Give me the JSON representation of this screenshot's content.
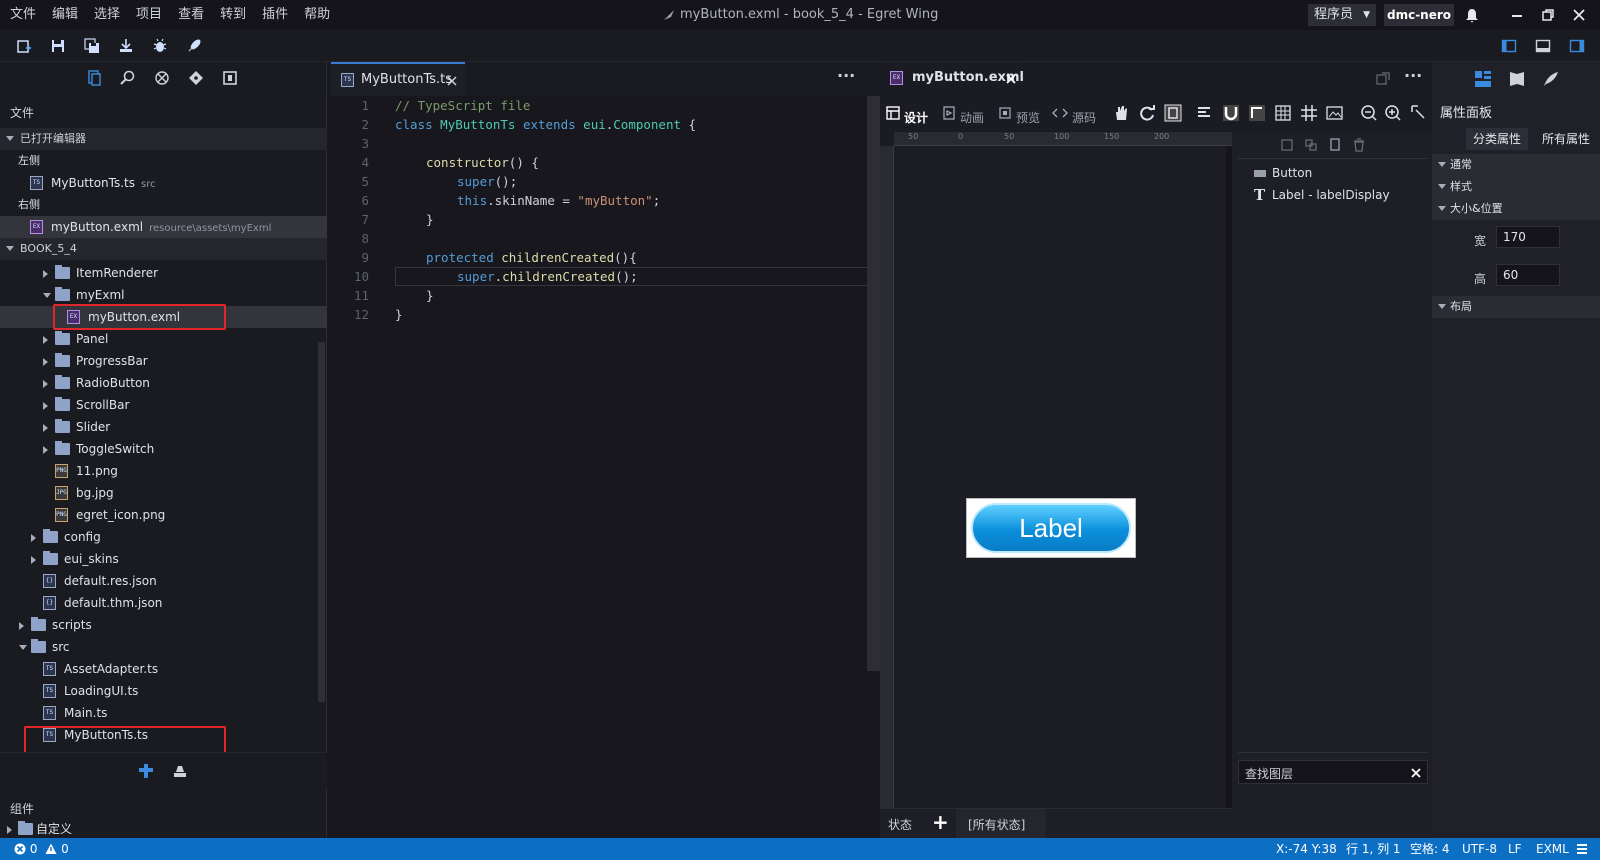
{
  "titlebar": {
    "menu": [
      "文件",
      "编辑",
      "选择",
      "项目",
      "查看",
      "转到",
      "插件",
      "帮助"
    ],
    "window_title": "myButton.exml - book_5_4 - Egret Wing",
    "role": "程序员",
    "role_arrow": "▼",
    "user": "dmc-nero"
  },
  "icons": {
    "bell": "bell-icon",
    "minimize": "minimize-icon",
    "restore": "restore-icon",
    "close": "close-icon"
  },
  "left_panel": {
    "section_files": "文件",
    "open_editors_head": "已打开编辑器",
    "left_group": "左侧",
    "left_file": "MyButtonTs.ts",
    "left_file_sub": "src",
    "right_group": "右侧",
    "right_file": "myButton.exml",
    "right_file_sub": "resource\\assets\\myExml",
    "project_head": "BOOK_5_4",
    "tree": {
      "item_renderer": "ItemRenderer",
      "my_exml": "myExml",
      "my_button_exml": "myButton.exml",
      "panel": "Panel",
      "progress_bar": "ProgressBar",
      "radio_button": "RadioButton",
      "scroll_bar": "ScrollBar",
      "slider": "Slider",
      "toggle_switch": "ToggleSwitch",
      "png11": "11.png",
      "bg": "bg.jpg",
      "egret_icon": "egret_icon.png",
      "config": "config",
      "eui_skins": "eui_skins",
      "default_res": "default.res.json",
      "default_thm": "default.thm.json",
      "scripts": "scripts",
      "src": "src",
      "asset_adapter": "AssetAdapter.ts",
      "loading_ui": "LoadingUI.ts",
      "main": "Main.ts",
      "my_button_ts": "MyButtonTs.ts"
    },
    "components_head": "组件",
    "custom": "自定义"
  },
  "editor": {
    "tab_label": "MyButtonTs.ts",
    "more": "···",
    "lines": [
      {
        "n": "1"
      },
      {
        "n": "2"
      },
      {
        "n": "3"
      },
      {
        "n": "4"
      },
      {
        "n": "5"
      },
      {
        "n": "6"
      },
      {
        "n": "7"
      },
      {
        "n": "8"
      },
      {
        "n": "9"
      },
      {
        "n": "10"
      },
      {
        "n": "11"
      },
      {
        "n": "12"
      }
    ],
    "code": {
      "l1": "// TypeScript file",
      "l2_kw": "class",
      "l2_name": " MyButtonTs ",
      "l2_ext": "extends",
      "l2_base": " eui",
      "l2_dot": ".",
      "l2_comp": "Component",
      "l2_end": " {",
      "l4_fn": "constructor",
      "l4_end": "() {",
      "l5_kw": "super",
      "l5_end": "();",
      "l6_this": "this",
      "l6_prop": ".skinName = ",
      "l6_str": "\"myButton\"",
      "l6_end": ";",
      "l7": "}",
      "l9_kw": "protected",
      "l9_fn": " childrenCreated",
      "l9_end": "(){",
      "l10_kw": "super",
      "l10_fn": ".childrenCreated",
      "l10_end": "();",
      "l11": "}",
      "l12": "}"
    }
  },
  "design": {
    "tab_label": "myButton.exml",
    "more": "···",
    "tools": {
      "design": "设计",
      "anim": "动画",
      "preview": "预览",
      "source": "源码"
    },
    "button_label": "Label",
    "layers": {
      "button": "Button",
      "label": "Label - labelDisplay"
    },
    "search_placeholder": "查找图层",
    "state_label": "状态",
    "add": "+",
    "all_states": "[所有状态]",
    "ruler_h": [
      "50",
      "0",
      "50",
      "100",
      "150",
      "200"
    ]
  },
  "props": {
    "title": "属性面板",
    "tab_category": "分类属性",
    "tab_all": "所有属性",
    "sections": {
      "common": "通常",
      "style": "样式",
      "size": "大小&位置",
      "layout": "布局"
    },
    "width_label": "宽",
    "width_value": "170",
    "height_label": "高",
    "height_value": "60"
  },
  "statusbar": {
    "errors": "0",
    "warnings": "0",
    "coords": "X:-74 Y:38",
    "position": "行 1, 列 1",
    "spaces": "空格: 4",
    "encoding": "UTF-8",
    "eol": "LF",
    "lang": "EXML"
  }
}
